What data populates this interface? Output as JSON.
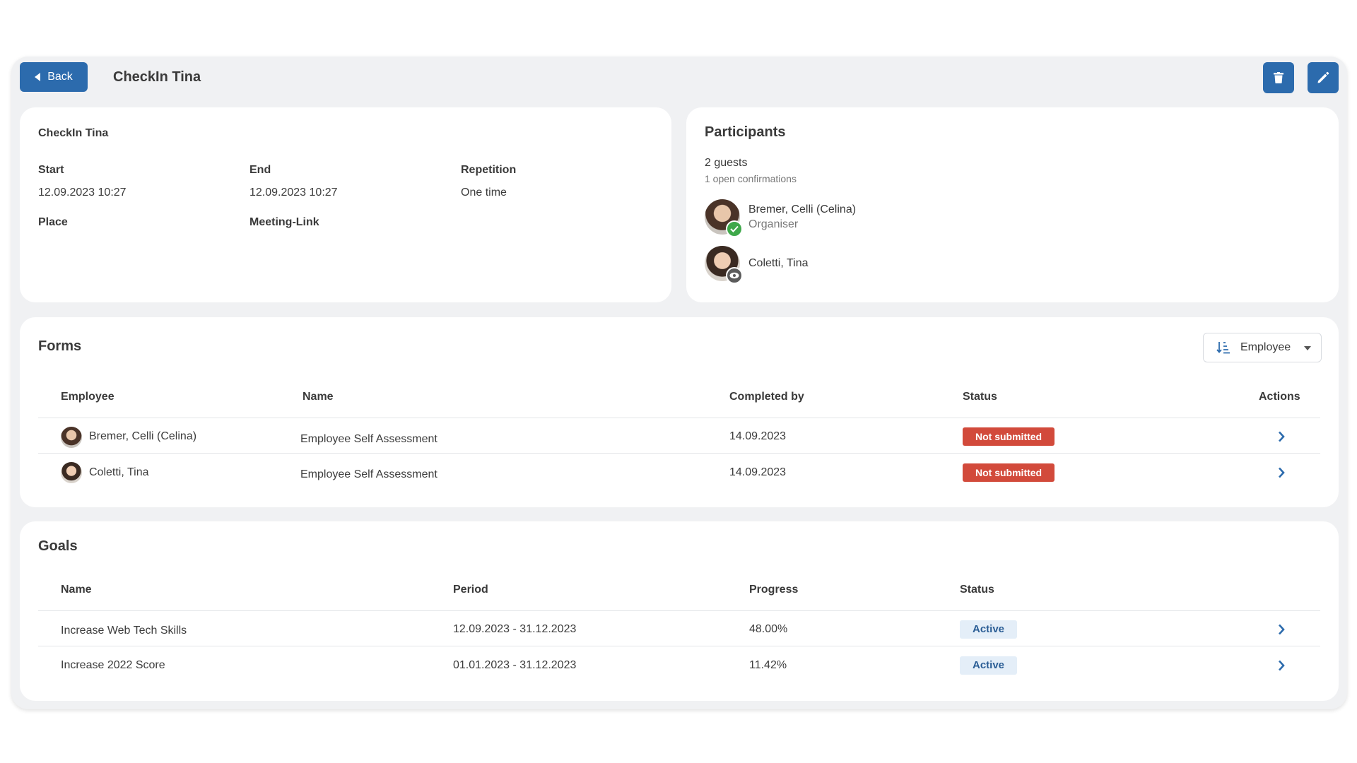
{
  "header": {
    "back_label": "Back",
    "title": "CheckIn Tina"
  },
  "info": {
    "title": "CheckIn Tina",
    "start_label": "Start",
    "start_value": "12.09.2023 10:27",
    "end_label": "End",
    "end_value": "12.09.2023 10:27",
    "repetition_label": "Repetition",
    "repetition_value": "One time",
    "place_label": "Place",
    "meeting_link_label": "Meeting-Link"
  },
  "participants": {
    "title": "Participants",
    "guests": "2 guests",
    "open_confirmations": "1 open confirmations",
    "people": [
      {
        "name": "Bremer, Celli (Celina)",
        "role": "Organiser",
        "badge": "check-icon"
      },
      {
        "name": "Coletti, Tina",
        "badge": "eye-icon"
      }
    ]
  },
  "forms": {
    "title": "Forms",
    "sort_label": "Employee",
    "columns": [
      "Employee",
      "Name",
      "Completed by",
      "Status",
      "Actions"
    ],
    "rows": [
      {
        "employee": "Bremer, Celli (Celina)",
        "name": "Employee Self Assessment",
        "completed_by": "14.09.2023",
        "status": "Not submitted"
      },
      {
        "employee": "Coletti, Tina",
        "name": "Employee Self Assessment",
        "completed_by": "14.09.2023",
        "status": "Not submitted"
      }
    ]
  },
  "goals": {
    "title": "Goals",
    "columns": [
      "Name",
      "Period",
      "Progress",
      "Status"
    ],
    "rows": [
      {
        "name": "Increase Web Tech Skills",
        "period": "12.09.2023 - 31.12.2023",
        "progress": "48.00%",
        "status": "Active"
      },
      {
        "name": "Increase 2022 Score",
        "period": "01.01.2023 - 31.12.2023",
        "progress": "11.42%",
        "status": "Active"
      }
    ]
  },
  "colors": {
    "primary": "#2c6bad",
    "danger": "#d24a3b",
    "success": "#3ea84a",
    "active_bg": "#e4eef8"
  }
}
